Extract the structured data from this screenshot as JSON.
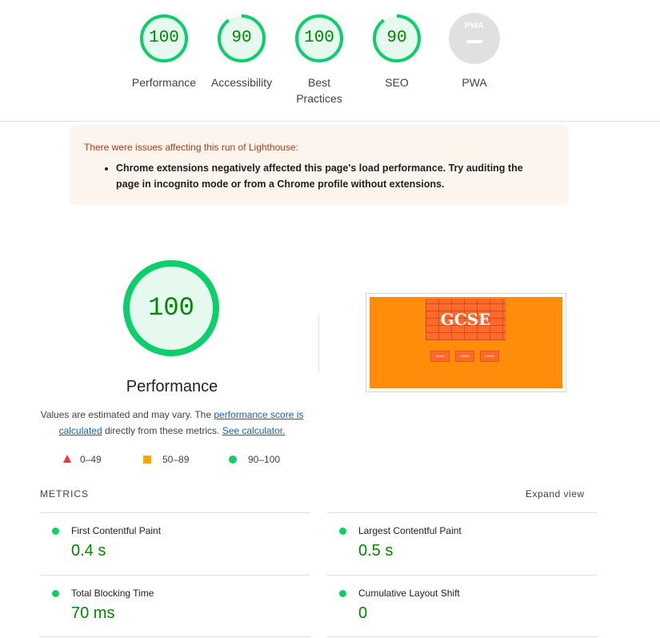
{
  "top_scores": [
    {
      "label": "Performance",
      "score": "100",
      "fraction": 1.0
    },
    {
      "label": "Accessibility",
      "score": "90",
      "fraction": 0.9
    },
    {
      "label": "Best Practices",
      "score": "100",
      "fraction": 1.0
    },
    {
      "label": "SEO",
      "score": "90",
      "fraction": 0.9
    },
    {
      "label": "PWA",
      "badge_text": "PWA"
    }
  ],
  "warning": {
    "title": "There were issues affecting this run of Lighthouse:",
    "item": "Chrome extensions negatively affected this page's load performance. Try auditing the page in incognito mode or from a Chrome profile without extensions."
  },
  "performance": {
    "score": "100",
    "fraction": 1.0,
    "title": "Performance",
    "desc_part1": "Values are estimated and may vary. The ",
    "link1": "performance score is calculated",
    "desc_part2": " directly from these metrics. ",
    "link2": "See calculator."
  },
  "legend": {
    "fail": "0–49",
    "average": "50–89",
    "pass": "90–100"
  },
  "screenshot": {
    "heading": "GCSE",
    "buttons": [
      "Music",
      "Maths",
      "Levels"
    ]
  },
  "metrics": {
    "header": "METRICS",
    "expand_label": "Expand view",
    "items": [
      {
        "name": "First Contentful Paint",
        "value": "0.4 s"
      },
      {
        "name": "Largest Contentful Paint",
        "value": "0.5 s"
      },
      {
        "name": "Total Blocking Time",
        "value": "70 ms"
      },
      {
        "name": "Cumulative Layout Shift",
        "value": "0"
      }
    ]
  },
  "colors": {
    "pass": "#0cce6b",
    "pass_text": "#008800",
    "pass_bg": "#e5f9ee",
    "average": "#ffa400",
    "fail": "#ff3333",
    "warning_bg": "#fdf4ee",
    "warning_title": "#b23c17",
    "screenshot_bg": "#ff8c0a"
  }
}
